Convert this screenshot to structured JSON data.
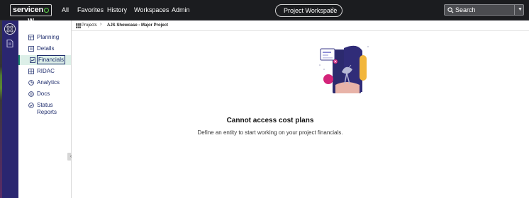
{
  "brand": {
    "logo_text_prefix": "servicen",
    "logo_text_suffix": "w"
  },
  "nav": {
    "items": [
      "All",
      "Favorites",
      "History",
      "Workspaces",
      "Admin"
    ]
  },
  "workspace": {
    "label": "Project Workspace",
    "star_icon": "star-icon"
  },
  "search": {
    "label": "Search",
    "icon": "search-icon",
    "dropdown_icon": "chevron-down-icon"
  },
  "rail": {
    "icons": [
      "apps-grid-icon",
      "document-icon"
    ]
  },
  "sidebar": {
    "items": [
      {
        "label": "Planning",
        "icon": "planning-icon"
      },
      {
        "label": "Details",
        "icon": "details-icon"
      },
      {
        "label": "Financials",
        "icon": "financials-icon",
        "active": true
      },
      {
        "label": "RIDAC",
        "icon": "ridac-icon"
      },
      {
        "label": "Analytics",
        "icon": "analytics-icon"
      },
      {
        "label": "Docs",
        "icon": "docs-icon"
      },
      {
        "label": "Status",
        "label_line2": "Reports",
        "icon": "status-reports-icon"
      }
    ],
    "collapse_icon": "chevron-left-icon"
  },
  "breadcrumb": {
    "root": "Projects",
    "current": "AJS Showcase - Major Project"
  },
  "empty_state": {
    "title": "Cannot access cost plans",
    "description": "Define an entity to start working on your project financials."
  },
  "colors": {
    "topbar": "#1b1c1f",
    "rail": "#2a2670",
    "accent_active": "#1f8e6e",
    "link_text": "#1f2d6d"
  }
}
